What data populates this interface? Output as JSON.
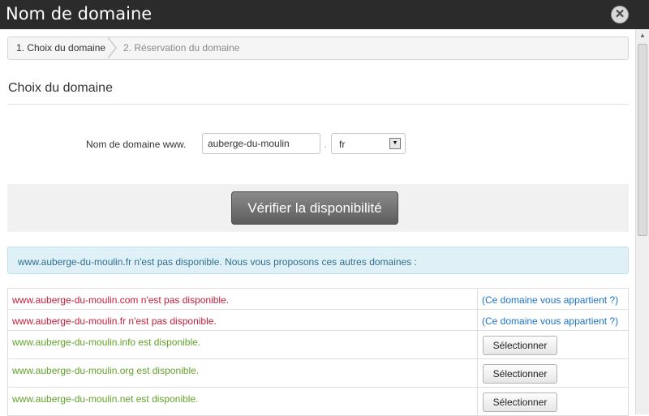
{
  "window": {
    "title": "Nom de domaine"
  },
  "breadcrumb": {
    "step1": "1. Choix du domaine",
    "step2": "2. Réservation du domaine"
  },
  "section": {
    "title": "Choix du domaine"
  },
  "form": {
    "label": "Nom de domaine www.",
    "domain_value": "auberge-du-moulin",
    "separator": ".",
    "tld_value": "fr",
    "verify_label": "Vérifier la disponibilité"
  },
  "info": {
    "message": "www.auberge-du-moulin.fr n'est pas disponible. Nous vous proposons ces autres domaines :"
  },
  "results": [
    {
      "text": "www.auberge-du-moulin.com n'est pas disponible.",
      "status": "unavailable",
      "action": "(Ce domaine vous appartient ?)"
    },
    {
      "text": "www.auberge-du-moulin.fr n'est pas disponible.",
      "status": "unavailable",
      "action": "(Ce domaine vous appartient ?)"
    },
    {
      "text": "www.auberge-du-moulin.info est disponible.",
      "status": "available",
      "action": "Sélectionner"
    },
    {
      "text": "www.auberge-du-moulin.org est disponible.",
      "status": "available",
      "action": "Sélectionner"
    },
    {
      "text": "www.auberge-du-moulin.net est disponible.",
      "status": "available",
      "action": "Sélectionner"
    }
  ],
  "icons": {
    "close": "close-icon",
    "select_arrow": "chevron-down-icon",
    "scroll_up": "arrow-up-icon"
  },
  "colors": {
    "unavailable": "#c0203a",
    "available": "#62a22a",
    "link": "#1e73c4",
    "titlebar": "#2b2b2b"
  }
}
